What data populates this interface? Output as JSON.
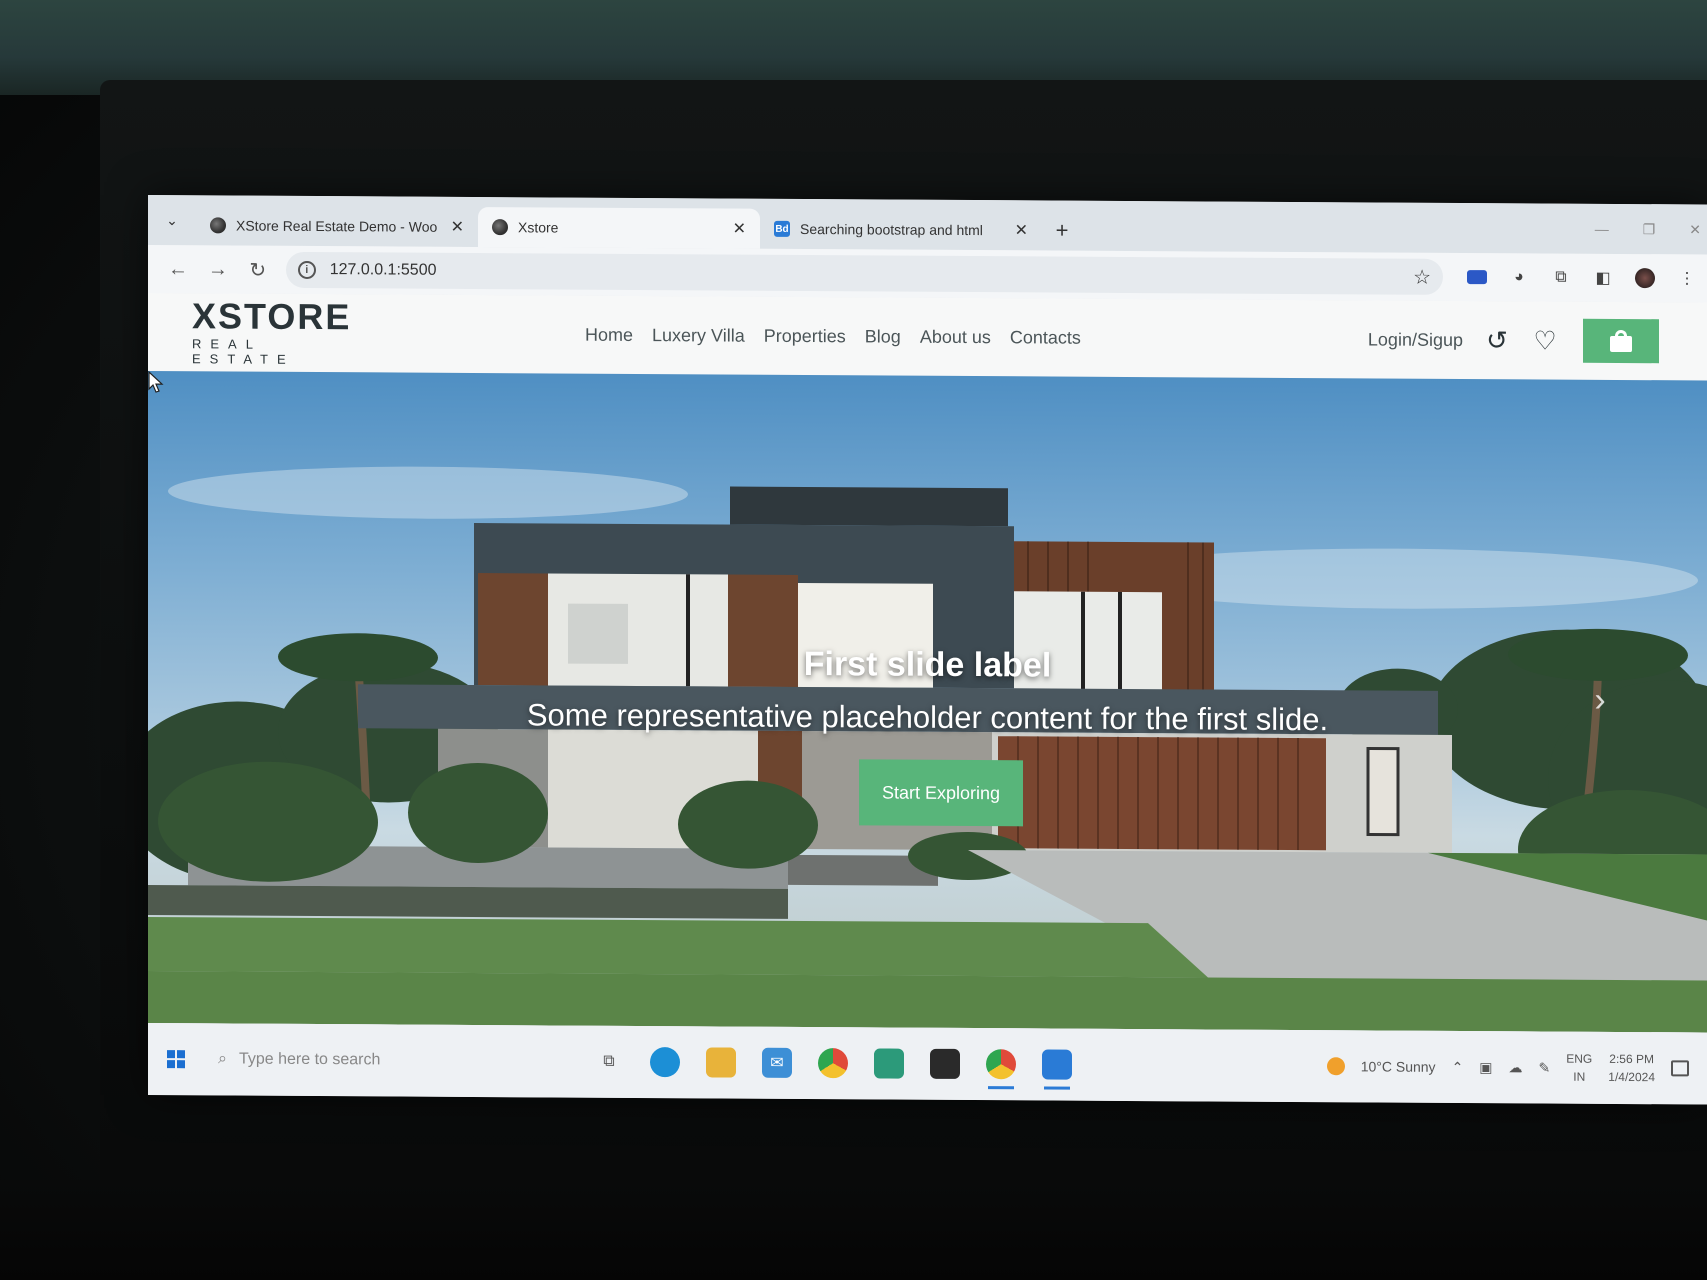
{
  "browser": {
    "tabs": [
      {
        "title": "XStore Real Estate Demo - Woo",
        "favicon": "globe-icon"
      },
      {
        "title": "Xstore",
        "favicon": "globe-icon"
      },
      {
        "title": "Searching bootstrap and html",
        "favicon": "bd-icon",
        "favicon_text": "Bd"
      }
    ],
    "url": "127.0.0.1:5500"
  },
  "site": {
    "logo_main": "XSTORE",
    "logo_sub": "REAL ESTATE",
    "nav": [
      "Home",
      "Luxery Villa",
      "Properties",
      "Blog",
      "About us",
      "Contacts"
    ],
    "login": "Login/Sigup",
    "accent": "#58b57a"
  },
  "hero": {
    "title": "First slide label",
    "text": "Some representative placeholder content for the first slide.",
    "button": "Start Exploring"
  },
  "taskbar": {
    "search_placeholder": "Type here to search",
    "weather": "10°C  Sunny",
    "lang_top": "ENG",
    "lang_bottom": "IN",
    "time": "2:56 PM",
    "date": "1/4/2024"
  }
}
